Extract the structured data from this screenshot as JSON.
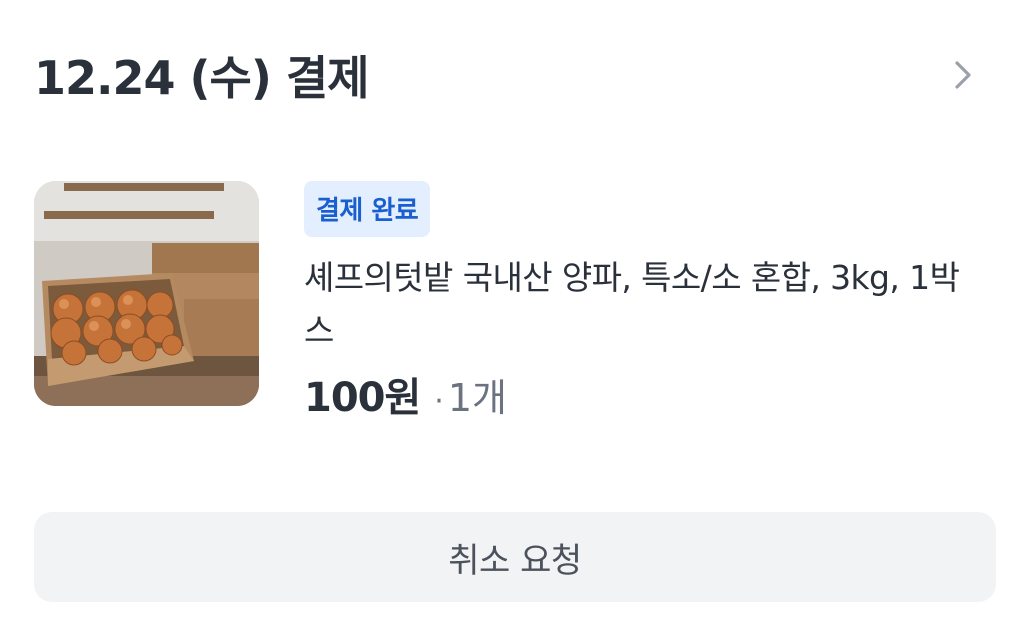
{
  "header": {
    "title": "12.24 (수) 결제",
    "chevron_icon": "chevron-right-icon"
  },
  "order": {
    "status_badge": "결제 완료",
    "product_name": "셰프의텃밭 국내산 양파, 특소/소 혼합, 3kg, 1박스",
    "price": "100원",
    "quantity_separator": "·",
    "quantity": "1개",
    "image_alt": "onion-box-product-image"
  },
  "actions": {
    "cancel_label": "취소 요청"
  },
  "colors": {
    "text_primary": "#2b313b",
    "text_secondary": "#6b7380",
    "badge_bg": "#e3efff",
    "badge_text": "#1a5fd0",
    "button_bg": "#f2f3f5"
  }
}
